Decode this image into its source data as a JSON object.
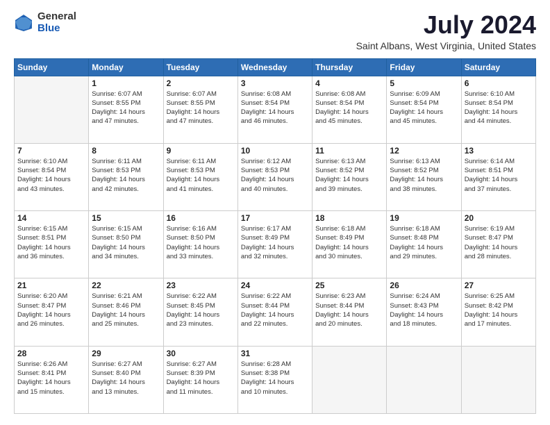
{
  "logo": {
    "general": "General",
    "blue": "Blue"
  },
  "title": {
    "month_year": "July 2024",
    "location": "Saint Albans, West Virginia, United States"
  },
  "header": {
    "days": [
      "Sunday",
      "Monday",
      "Tuesday",
      "Wednesday",
      "Thursday",
      "Friday",
      "Saturday"
    ]
  },
  "weeks": [
    [
      {
        "day": "",
        "info": ""
      },
      {
        "day": "1",
        "info": "Sunrise: 6:07 AM\nSunset: 8:55 PM\nDaylight: 14 hours\nand 47 minutes."
      },
      {
        "day": "2",
        "info": "Sunrise: 6:07 AM\nSunset: 8:55 PM\nDaylight: 14 hours\nand 47 minutes."
      },
      {
        "day": "3",
        "info": "Sunrise: 6:08 AM\nSunset: 8:54 PM\nDaylight: 14 hours\nand 46 minutes."
      },
      {
        "day": "4",
        "info": "Sunrise: 6:08 AM\nSunset: 8:54 PM\nDaylight: 14 hours\nand 45 minutes."
      },
      {
        "day": "5",
        "info": "Sunrise: 6:09 AM\nSunset: 8:54 PM\nDaylight: 14 hours\nand 45 minutes."
      },
      {
        "day": "6",
        "info": "Sunrise: 6:10 AM\nSunset: 8:54 PM\nDaylight: 14 hours\nand 44 minutes."
      }
    ],
    [
      {
        "day": "7",
        "info": "Sunrise: 6:10 AM\nSunset: 8:54 PM\nDaylight: 14 hours\nand 43 minutes."
      },
      {
        "day": "8",
        "info": "Sunrise: 6:11 AM\nSunset: 8:53 PM\nDaylight: 14 hours\nand 42 minutes."
      },
      {
        "day": "9",
        "info": "Sunrise: 6:11 AM\nSunset: 8:53 PM\nDaylight: 14 hours\nand 41 minutes."
      },
      {
        "day": "10",
        "info": "Sunrise: 6:12 AM\nSunset: 8:53 PM\nDaylight: 14 hours\nand 40 minutes."
      },
      {
        "day": "11",
        "info": "Sunrise: 6:13 AM\nSunset: 8:52 PM\nDaylight: 14 hours\nand 39 minutes."
      },
      {
        "day": "12",
        "info": "Sunrise: 6:13 AM\nSunset: 8:52 PM\nDaylight: 14 hours\nand 38 minutes."
      },
      {
        "day": "13",
        "info": "Sunrise: 6:14 AM\nSunset: 8:51 PM\nDaylight: 14 hours\nand 37 minutes."
      }
    ],
    [
      {
        "day": "14",
        "info": "Sunrise: 6:15 AM\nSunset: 8:51 PM\nDaylight: 14 hours\nand 36 minutes."
      },
      {
        "day": "15",
        "info": "Sunrise: 6:15 AM\nSunset: 8:50 PM\nDaylight: 14 hours\nand 34 minutes."
      },
      {
        "day": "16",
        "info": "Sunrise: 6:16 AM\nSunset: 8:50 PM\nDaylight: 14 hours\nand 33 minutes."
      },
      {
        "day": "17",
        "info": "Sunrise: 6:17 AM\nSunset: 8:49 PM\nDaylight: 14 hours\nand 32 minutes."
      },
      {
        "day": "18",
        "info": "Sunrise: 6:18 AM\nSunset: 8:49 PM\nDaylight: 14 hours\nand 30 minutes."
      },
      {
        "day": "19",
        "info": "Sunrise: 6:18 AM\nSunset: 8:48 PM\nDaylight: 14 hours\nand 29 minutes."
      },
      {
        "day": "20",
        "info": "Sunrise: 6:19 AM\nSunset: 8:47 PM\nDaylight: 14 hours\nand 28 minutes."
      }
    ],
    [
      {
        "day": "21",
        "info": "Sunrise: 6:20 AM\nSunset: 8:47 PM\nDaylight: 14 hours\nand 26 minutes."
      },
      {
        "day": "22",
        "info": "Sunrise: 6:21 AM\nSunset: 8:46 PM\nDaylight: 14 hours\nand 25 minutes."
      },
      {
        "day": "23",
        "info": "Sunrise: 6:22 AM\nSunset: 8:45 PM\nDaylight: 14 hours\nand 23 minutes."
      },
      {
        "day": "24",
        "info": "Sunrise: 6:22 AM\nSunset: 8:44 PM\nDaylight: 14 hours\nand 22 minutes."
      },
      {
        "day": "25",
        "info": "Sunrise: 6:23 AM\nSunset: 8:44 PM\nDaylight: 14 hours\nand 20 minutes."
      },
      {
        "day": "26",
        "info": "Sunrise: 6:24 AM\nSunset: 8:43 PM\nDaylight: 14 hours\nand 18 minutes."
      },
      {
        "day": "27",
        "info": "Sunrise: 6:25 AM\nSunset: 8:42 PM\nDaylight: 14 hours\nand 17 minutes."
      }
    ],
    [
      {
        "day": "28",
        "info": "Sunrise: 6:26 AM\nSunset: 8:41 PM\nDaylight: 14 hours\nand 15 minutes."
      },
      {
        "day": "29",
        "info": "Sunrise: 6:27 AM\nSunset: 8:40 PM\nDaylight: 14 hours\nand 13 minutes."
      },
      {
        "day": "30",
        "info": "Sunrise: 6:27 AM\nSunset: 8:39 PM\nDaylight: 14 hours\nand 11 minutes."
      },
      {
        "day": "31",
        "info": "Sunrise: 6:28 AM\nSunset: 8:38 PM\nDaylight: 14 hours\nand 10 minutes."
      },
      {
        "day": "",
        "info": ""
      },
      {
        "day": "",
        "info": ""
      },
      {
        "day": "",
        "info": ""
      }
    ]
  ]
}
